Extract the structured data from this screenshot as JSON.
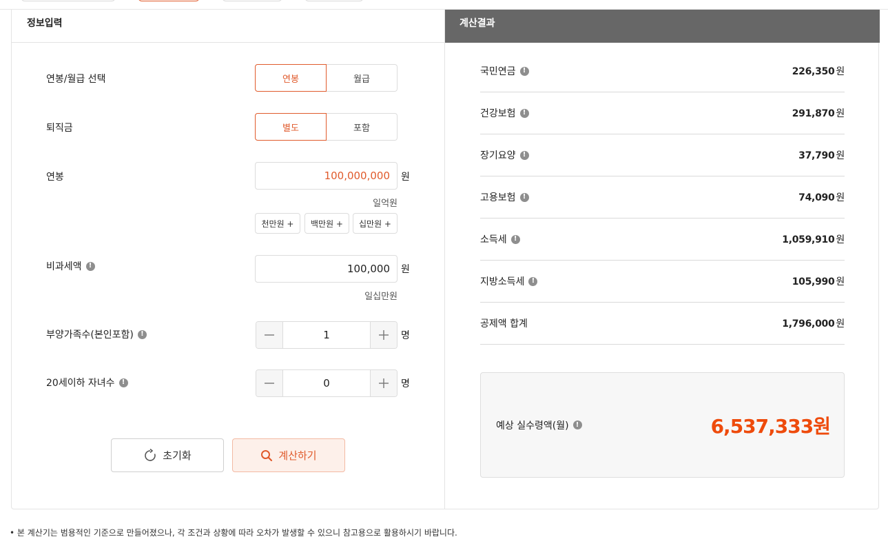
{
  "colors": {
    "accent": "#e05a2b",
    "result_highlight": "#ee4b0c",
    "result_header_bg": "#676767"
  },
  "input_panel": {
    "title": "정보입력",
    "pay_type": {
      "label": "연봉/월급 선택",
      "options": [
        "연봉",
        "월급"
      ],
      "selected": "연봉"
    },
    "severance": {
      "label": "퇴직금",
      "options": [
        "별도",
        "포함"
      ],
      "selected": "별도"
    },
    "salary": {
      "label": "연봉",
      "value": "100,000,000",
      "unit": "원",
      "hint": "일억원",
      "quick_buttons": [
        "천만원 +",
        "백만원 +",
        "십만원 +"
      ]
    },
    "non_taxable": {
      "label": "비과세액",
      "value": "100,000",
      "unit": "원",
      "hint": "일십만원"
    },
    "dependents": {
      "label": "부양가족수(본인포함)",
      "value": "1",
      "unit": "명"
    },
    "children": {
      "label": "20세이하 자녀수",
      "value": "0",
      "unit": "명"
    },
    "reset_label": "초기화",
    "calculate_label": "계산하기"
  },
  "result_panel": {
    "title": "계산결과",
    "rows": [
      {
        "label": "국민연금",
        "value": "226,350",
        "unit": "원",
        "info": true
      },
      {
        "label": "건강보험",
        "value": "291,870",
        "unit": "원",
        "info": true
      },
      {
        "label": "장기요양",
        "value": "37,790",
        "unit": "원",
        "info": true
      },
      {
        "label": "고용보험",
        "value": "74,090",
        "unit": "원",
        "info": true
      },
      {
        "label": "소득세",
        "value": "1,059,910",
        "unit": "원",
        "info": true
      },
      {
        "label": "지방소득세",
        "value": "105,990",
        "unit": "원",
        "info": true
      },
      {
        "label": "공제액 합계",
        "value": "1,796,000",
        "unit": "원",
        "info": false
      }
    ],
    "net_label": "예상 실수령액(월)",
    "net_value": "6,537,333원"
  },
  "disclaimer": "• 본 계산기는 범용적인 기준으로 만들어졌으나, 각 조건과 상황에 따라 오차가 발생할 수 있으니 참고용으로 활용하시기 바랍니다.",
  "icons": {
    "info": "info-icon",
    "reset": "refresh-icon",
    "search": "search-icon",
    "minus": "minus-icon",
    "plus": "plus-icon"
  }
}
